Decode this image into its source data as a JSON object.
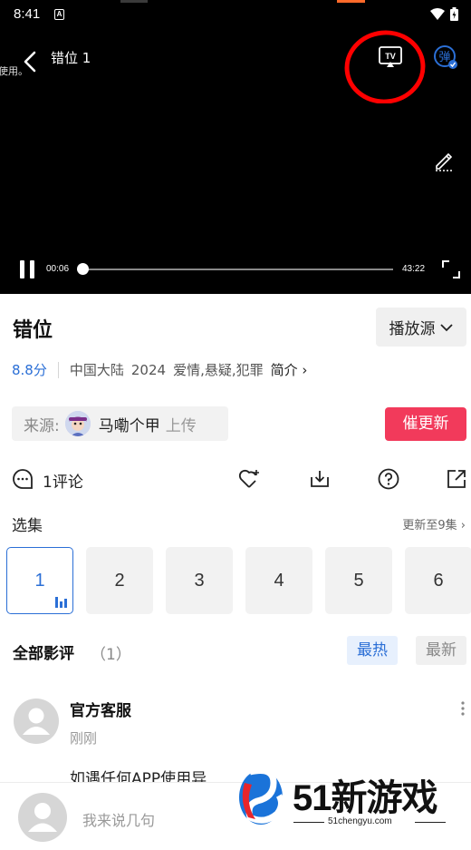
{
  "status_bar": {
    "time": "8:41",
    "badge": "A"
  },
  "player": {
    "edge_text": "使用。",
    "title": "错位 1",
    "tv_label": "TV",
    "danmu_label": "弹",
    "current_time": "00:06",
    "total_time": "43:22",
    "progress_fraction": 0.003
  },
  "info": {
    "title": "错位",
    "source_button": "播放源",
    "score": "8.8分",
    "region": "中国大陆",
    "year": "2024",
    "genres": "爱情,悬疑,犯罪",
    "intro": "简介",
    "source_label": "来源:",
    "uploader": "马嘞个甲",
    "upload_label": "上传",
    "urge_button": "催更新"
  },
  "actions": {
    "comments": "1评论"
  },
  "episodes": {
    "heading": "选集",
    "update_text": "更新至9集",
    "items": [
      "1",
      "2",
      "3",
      "4",
      "5",
      "6"
    ],
    "active_index": 0
  },
  "reviews": {
    "heading": "全部影评",
    "count": "（1）",
    "sort_hot": "最热",
    "sort_new": "最新",
    "items": [
      {
        "name": "官方客服",
        "time": "刚刚",
        "text": "如遇任何APP使用异"
      }
    ]
  },
  "input": {
    "placeholder": "我来说几句"
  },
  "watermark": {
    "brand": "51新游戏",
    "url": "51chengyu.com"
  },
  "colors": {
    "accent": "#2b6fd6",
    "urge": "#f23a5b",
    "annotation": "#ff0000"
  }
}
